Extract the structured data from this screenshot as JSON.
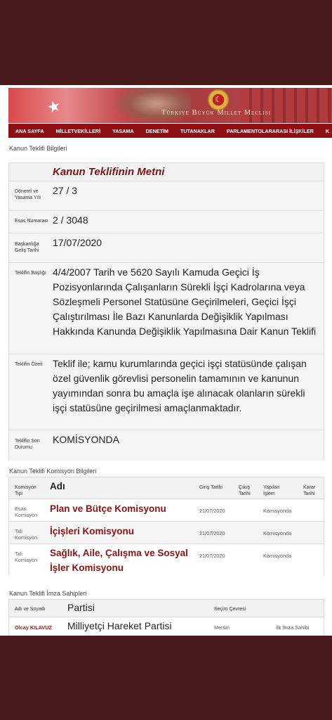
{
  "header": {
    "site_title": "Türkiye Büyük Millet Meclisi"
  },
  "nav": [
    "ANA SAYFA",
    "MİLLETVEKİLLERİ",
    "YASAMA",
    "DENETİM",
    "TUTANAKLAR",
    "PARLAMENTOLARARASI İLİŞKİLER",
    "K"
  ],
  "bill_info": {
    "section_title": "Kanun Teklifi Bilgileri",
    "text_header": "Kanun Teklifinin Metni",
    "rows": [
      {
        "label": "Dönemi ve Yasama Yılı",
        "value": "27 / 3"
      },
      {
        "label": "Esas Numarası",
        "value": "2 / 3048"
      },
      {
        "label": "Başkanlığa Geliş Tarihi",
        "value": "17/07/2020"
      },
      {
        "label": "Teklifin Başlığı",
        "value": "4/4/2007 Tarih ve 5620 Sayılı Kamuda Geçici İş Pozisyonlarında Çalışanların Sürekli İşçi Kadrolarına veya Sözleşmeli Personel Statüsüne Geçirilmeleri, Geçici İşçi Çalıştırılması İle Bazı Kanunlarda Değişiklik Yapılması Hakkında Kanunda Değişiklik Yapılmasına Dair Kanun Teklifi"
      },
      {
        "label": "Teklifin Özeti",
        "value": "Teklif ile; kamu kurumlarında geçici işçi statüsünde çalışan özel güvenlik görevlisi personelin tamamının ve kanunun yayımından sonra bu amaçla işe alınacak olanların sürekli işçi statüsüne geçirilmesi amaçlanmaktadır."
      },
      {
        "label": "Teklifin Son Durumu",
        "value": "KOMİSYONDA"
      }
    ]
  },
  "commission": {
    "section_title": "Kanun Teklifi Komisyon Bilgileri",
    "headers": [
      "Komisyon Tipi",
      "Adı",
      "Giriş Tarihi",
      "Çıkış Tarihi",
      "Yapılan İşlem",
      "Karar Tarihi"
    ],
    "rows": [
      {
        "tip": "Esas Komisyon",
        "name": "Plan ve Bütçe Komisyonu",
        "date": "21/07/2020",
        "status": "Komisyonda"
      },
      {
        "tip": "Tali Komisyon",
        "name": "İçişleri Komisyonu",
        "date": "21/07/2020",
        "status": "Komisyonda"
      },
      {
        "tip": "Tali Komisyon",
        "name": "Sağlık, Aile, Çalışma ve Sosyal İşler Komisyonu",
        "date": "21/07/2020",
        "status": "Komisyonda"
      }
    ]
  },
  "signers": {
    "section_title": "Kanun Teklifi İmza Sahipleri",
    "headers": [
      "Adı ve Soyadı",
      "Partisi",
      "Seçim Çevresi"
    ],
    "rows": [
      {
        "name": "Olcay KILAVUZ",
        "party": "Milliyetçi Hareket Partisi",
        "region": "Mersin",
        "role": "İlk İmza Sahibi"
      }
    ]
  }
}
